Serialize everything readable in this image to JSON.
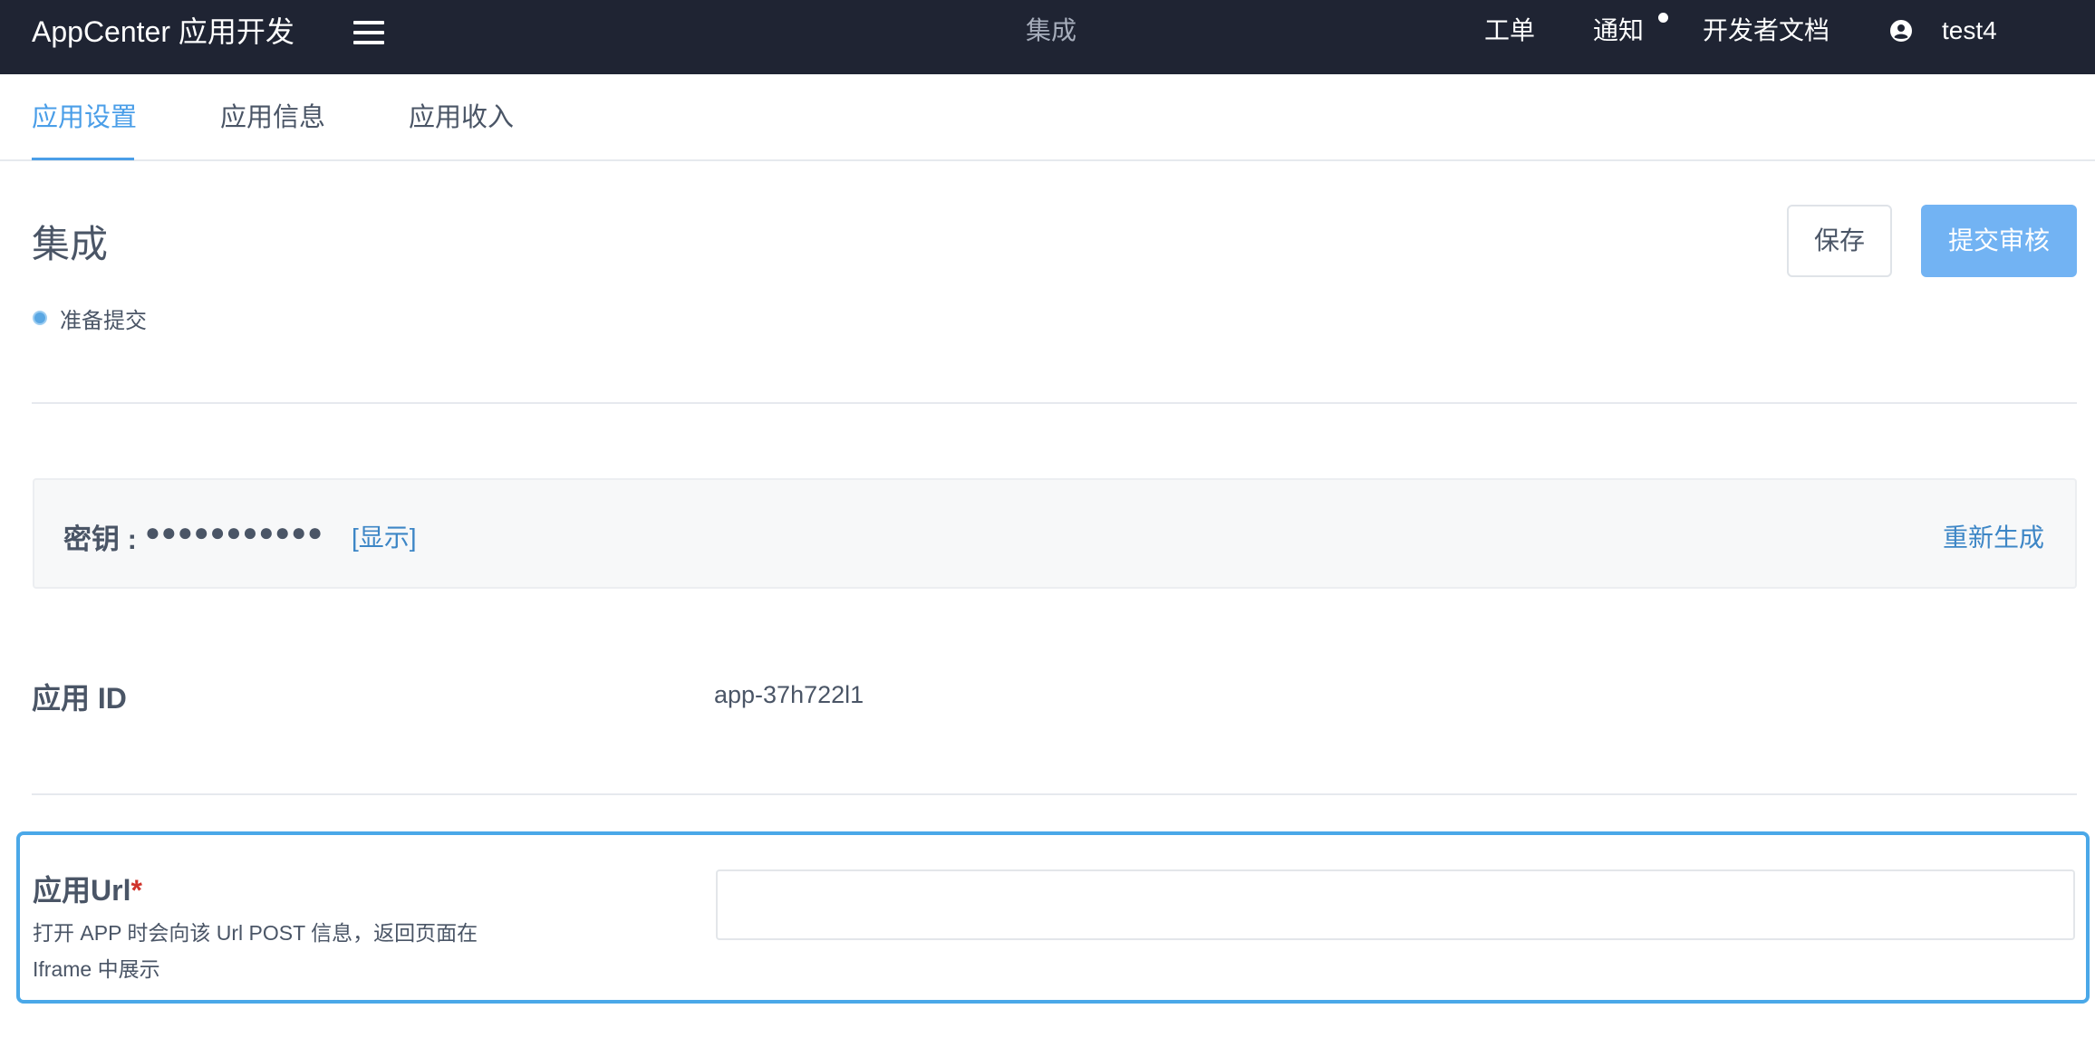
{
  "header": {
    "brand": "AppCenter 应用开发",
    "center_title": "集成",
    "nav": {
      "tickets": "工单",
      "notifications": "通知",
      "dev_docs": "开发者文档",
      "username": "test4"
    }
  },
  "tabs": [
    {
      "label": "应用设置",
      "active": true
    },
    {
      "label": "应用信息",
      "active": false
    },
    {
      "label": "应用收入",
      "active": false
    }
  ],
  "page": {
    "title": "集成",
    "save_label": "保存",
    "submit_label": "提交审核",
    "status": "准备提交"
  },
  "secret": {
    "label": "密钥 :",
    "masked_value": "●●●●●●●●●●●",
    "show_label": "[显示]",
    "regenerate_label": "重新生成"
  },
  "app_id": {
    "label": "应用 ID",
    "value": "app-37h722l1"
  },
  "app_url": {
    "label": "应用Url",
    "required_mark": "*",
    "description": "打开 APP 时会向该 Url POST 信息，返回页面在 Iframe 中展示",
    "value": "",
    "placeholder": ""
  },
  "colors": {
    "header_bg": "#1f2433",
    "accent": "#4a9ee8",
    "submit_button": "#72b3f3",
    "link": "#3d86c6",
    "required": "#d0342c",
    "focus_border": "#4aa8e8"
  }
}
